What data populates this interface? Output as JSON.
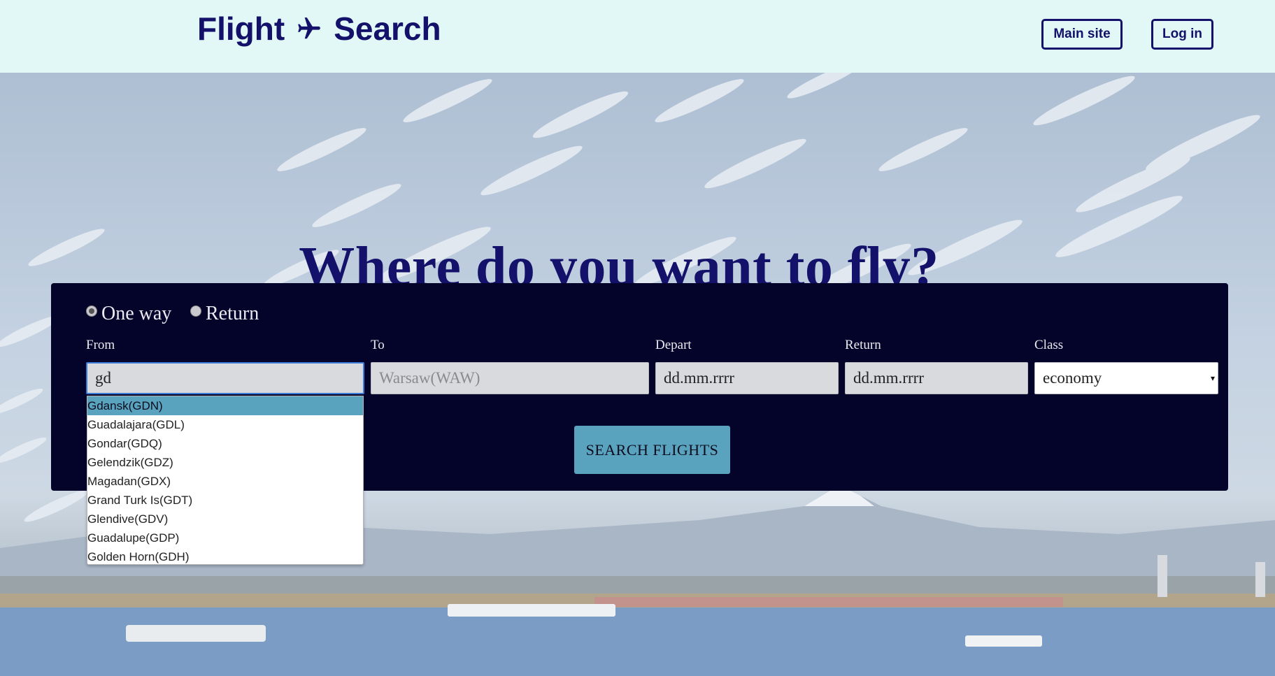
{
  "header": {
    "brand_left": "Flight",
    "brand_right": "Search",
    "plane_icon": "airplane-icon",
    "main_site_label": "Main site",
    "login_label": "Log in"
  },
  "hero": {
    "title": "Where do you want to fly?"
  },
  "search": {
    "trip_types": [
      {
        "label": "One way",
        "selected": true
      },
      {
        "label": "Return",
        "selected": false
      }
    ],
    "fields": {
      "from": {
        "label": "From",
        "value": "gd"
      },
      "to": {
        "label": "To",
        "placeholder": "Warsaw(WAW)"
      },
      "depart": {
        "label": "Depart",
        "value": "dd.mm.rrrr"
      },
      "return": {
        "label": "Return",
        "value": "dd.mm.rrrr"
      },
      "class": {
        "label": "Class",
        "value": "economy"
      }
    },
    "submit_label": "SEARCH FLIGHTS",
    "suggestions": [
      "Gdansk(GDN)",
      "Guadalajara(GDL)",
      "Gondar(GDQ)",
      "Gelendzik(GDZ)",
      "Magadan(GDX)",
      "Grand Turk Is(GDT)",
      "Glendive(GDV)",
      "Guadalupe(GDP)",
      "Golden Horn(GDH)"
    ],
    "active_suggestion": "Gdansk(GDN)"
  },
  "colors": {
    "brand": "#13116a",
    "header_bg": "#e2f8f6",
    "panel_bg": "#04032a",
    "accent": "#5aa3be"
  }
}
